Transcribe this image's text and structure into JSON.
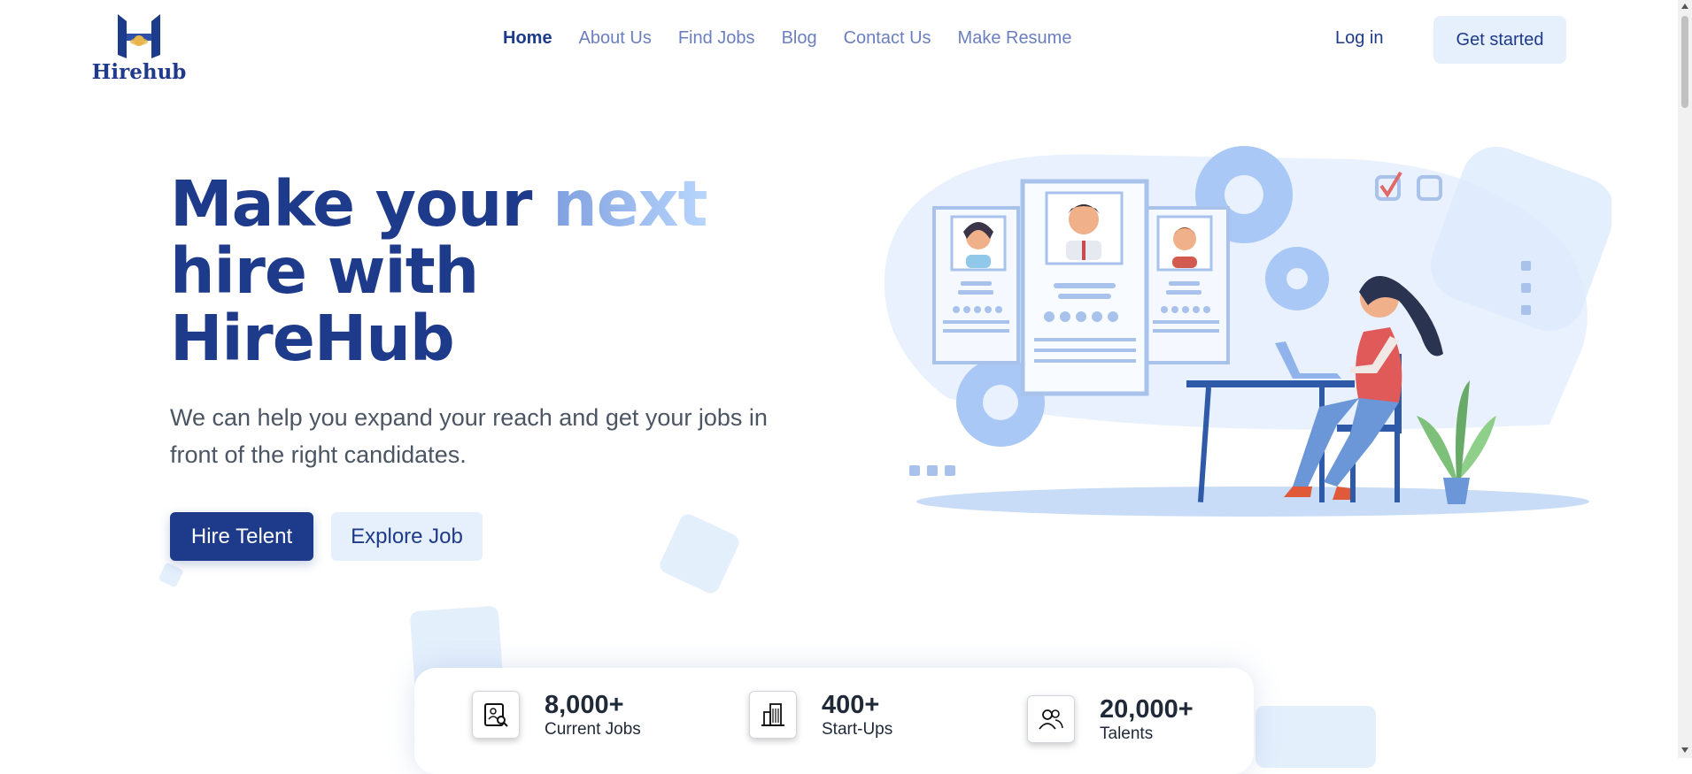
{
  "brand": {
    "name": "Hirehub",
    "color": "#1e3a8a",
    "accent": "#e6f0fd"
  },
  "nav": {
    "items": [
      {
        "label": "Home",
        "active": true
      },
      {
        "label": "About Us"
      },
      {
        "label": "Find Jobs"
      },
      {
        "label": "Blog"
      },
      {
        "label": "Contact Us"
      },
      {
        "label": "Make Resume"
      }
    ],
    "login_label": "Log in",
    "cta_label": "Get started"
  },
  "hero": {
    "title_part1": "Make your ",
    "title_highlight": "next",
    "title_line2": "hire with",
    "title_line3": "HireHub",
    "subtitle": "We can help you expand your reach and get your jobs in front of the right candidates.",
    "primary_button": "Hire Telent",
    "secondary_button": "Explore Job"
  },
  "stats": [
    {
      "value": "8,000+",
      "label": "Current Jobs",
      "icon": "job-search-icon"
    },
    {
      "value": "400+",
      "label": "Start-Ups",
      "icon": "building-icon"
    },
    {
      "value": "20,000+",
      "label": "Talents",
      "icon": "users-icon"
    }
  ]
}
